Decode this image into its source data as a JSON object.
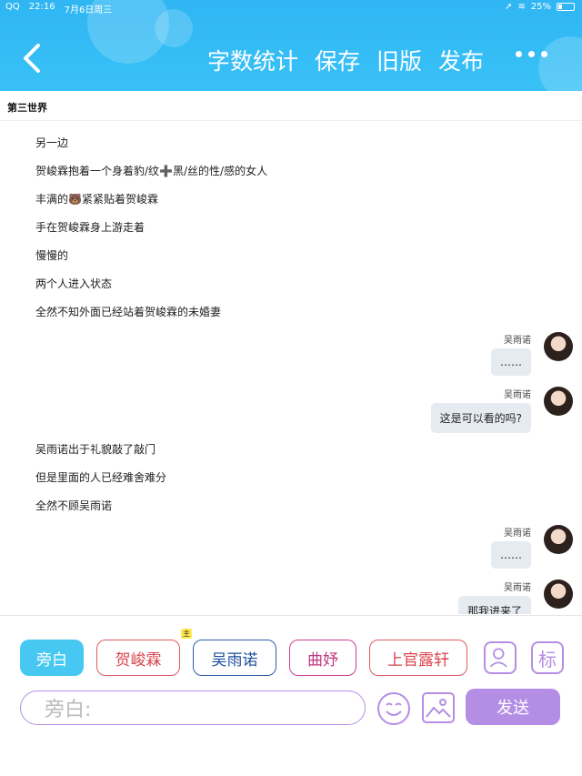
{
  "status": {
    "app": "QQ",
    "time": "22:16",
    "date": "7月6日周三",
    "battery": "25%"
  },
  "header": {
    "items": [
      "字数统计",
      "保存",
      "旧版",
      "发布"
    ]
  },
  "story_title": "第三世界",
  "narration_1": [
    "另一边",
    "贺峻霖抱着一个身着豹/纹➕黑/丝的性/感的女人",
    "丰满的🐻紧紧贴着贺峻霖",
    "手在贺峻霖身上游走着",
    "慢慢的",
    "两个人进入状态",
    "全然不知外面已经站着贺峻霖的未婚妻"
  ],
  "messages_1": [
    {
      "name": "吴雨诺",
      "text": "……"
    },
    {
      "name": "吴雨诺",
      "text": "这是可以看的吗?"
    }
  ],
  "narration_2": [
    "吴雨诺出于礼貌敲了敲门",
    "但是里面的人已经难舍难分",
    "全然不顾吴雨诺"
  ],
  "messages_2": [
    {
      "name": "吴雨诺",
      "text": "……"
    },
    {
      "name": "吴雨诺",
      "text": "那我进来了"
    }
  ],
  "roles": [
    "旁白",
    "贺峻霖",
    "吴雨诺",
    "曲妤",
    "上官露轩"
  ],
  "role_tag": "主",
  "label_icon": "标",
  "input_placeholder": "旁白:",
  "send_label": "发送",
  "colors": {
    "header": "#39c1f7",
    "accent": "#b48de5",
    "active_role": "#47c8f2"
  }
}
